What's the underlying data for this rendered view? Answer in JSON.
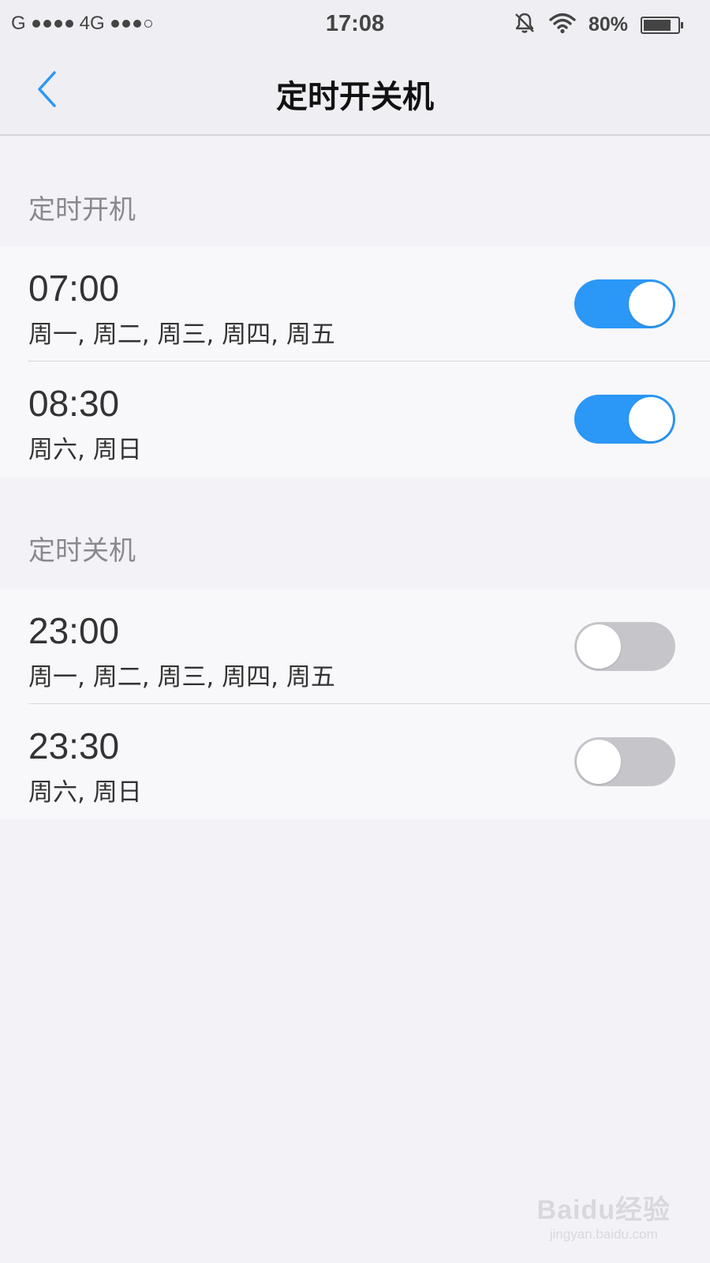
{
  "status_bar": {
    "carrier": "G",
    "network": "4G",
    "time": "17:08",
    "battery_percent": "80%",
    "battery_level": 0.8,
    "icons": [
      "signal-dots-icon",
      "mute-bell-icon",
      "wifi-icon",
      "battery-icon"
    ]
  },
  "nav": {
    "title": "定时开关机",
    "back_icon": "chevron-left-icon",
    "accent_color": "#2b97f6"
  },
  "power_on": {
    "header": "定时开机",
    "items": [
      {
        "time": "07:00",
        "days": "周一, 周二, 周三, 周四, 周五",
        "enabled": true
      },
      {
        "time": "08:30",
        "days": "周六, 周日",
        "enabled": true
      }
    ]
  },
  "power_off": {
    "header": "定时关机",
    "items": [
      {
        "time": "23:00",
        "days": "周一, 周二, 周三, 周四, 周五",
        "enabled": false
      },
      {
        "time": "23:30",
        "days": "周六, 周日",
        "enabled": false
      }
    ]
  },
  "watermark": {
    "logo": "Baidu经验",
    "url": "jingyan.baidu.com"
  },
  "colors": {
    "toggle_on": "#2b97f6",
    "toggle_off": "#c6c5ca",
    "background": "#f3f2f6"
  }
}
